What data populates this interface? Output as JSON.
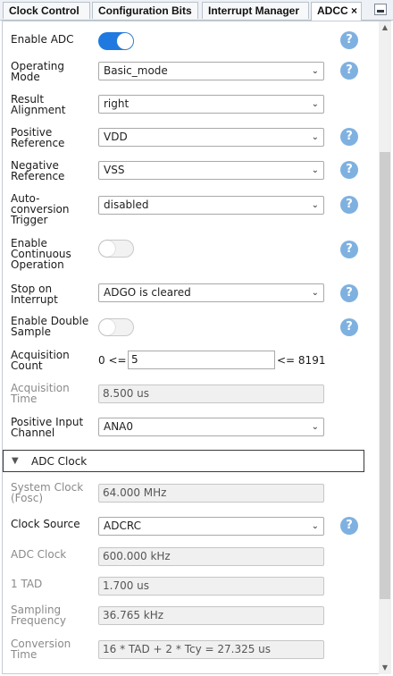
{
  "tabs": [
    {
      "label": "Clock Control"
    },
    {
      "label": "Configuration Bits"
    },
    {
      "label": "Interrupt Manager"
    },
    {
      "label": "ADCC"
    }
  ],
  "tab_close_glyph": "×",
  "help_glyph": "?",
  "dropdown_arrow": "⌄",
  "fields": {
    "enable_adc": {
      "label": "Enable ADC",
      "state": "on"
    },
    "operating_mode": {
      "label1": "Operating",
      "label2": "Mode",
      "value": "Basic_mode"
    },
    "result_alignment": {
      "label1": "Result",
      "label2": "Alignment",
      "value": "right"
    },
    "positive_reference": {
      "label1": "Positive",
      "label2": "Reference",
      "value": "VDD"
    },
    "negative_reference": {
      "label1": "Negative",
      "label2": "Reference",
      "value": "VSS"
    },
    "auto_conversion_trigger": {
      "label1": "Auto-",
      "label2": "conversion",
      "label3": "Trigger",
      "value": "disabled"
    },
    "enable_continuous_operation": {
      "label1": "Enable",
      "label2": "Continuous",
      "label3": "Operation",
      "state": "off"
    },
    "stop_on_interrupt": {
      "label1": "Stop on",
      "label2": "Interrupt",
      "value": "ADGO is cleared"
    },
    "enable_double_sample": {
      "label1": "Enable Double",
      "label2": "Sample",
      "state": "off"
    },
    "acquisition_count": {
      "label1": "Acquisition",
      "label2": "Count",
      "min_text": "0 <=",
      "value": "5",
      "max_text": "<= 8191"
    },
    "acquisition_time": {
      "label1": "Acquisition",
      "label2": "Time",
      "value": "8.500 us"
    },
    "positive_input_channel": {
      "label1": "Positive Input",
      "label2": "Channel",
      "value": "ANA0"
    }
  },
  "adc_clock_section": {
    "title": "ADC Clock",
    "system_clock": {
      "label1": "System Clock",
      "label2": "(Fosc)",
      "value": "64.000 MHz"
    },
    "clock_source": {
      "label": "Clock Source",
      "value": "ADCRC"
    },
    "adc_clock": {
      "label": "ADC Clock",
      "value": "600.000 kHz"
    },
    "one_tad": {
      "label": "1 TAD",
      "value": "1.700 us"
    },
    "sampling_frequency": {
      "label1": "Sampling",
      "label2": "Frequency",
      "value": "36.765 kHz"
    },
    "conversion_time": {
      "label1": "Conversion",
      "label2": "Time",
      "value": "16 * TAD + 2 * Tcy = 27.325 us"
    }
  },
  "colors": {
    "accent": "#1e7ae0",
    "help_icon": "#7fb1e0",
    "disabled_text": "#8a8a8a"
  }
}
